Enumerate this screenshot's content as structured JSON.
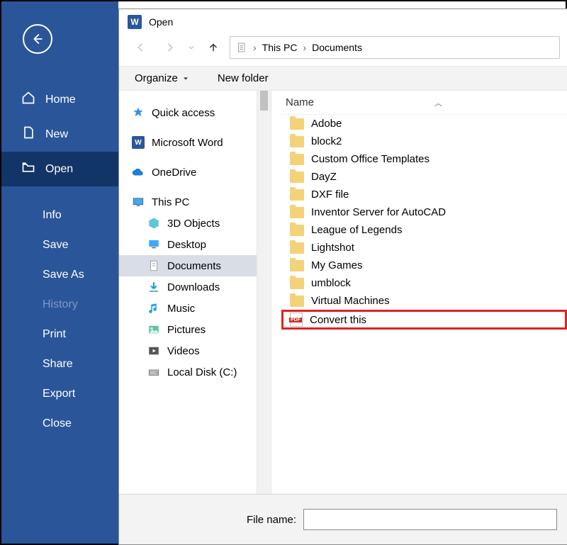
{
  "backstage": {
    "items": [
      {
        "label": "Home",
        "icon": "home-icon"
      },
      {
        "label": "New",
        "icon": "new-icon"
      },
      {
        "label": "Open",
        "icon": "open-icon",
        "selected": true
      },
      {
        "label": "Info",
        "sub": true
      },
      {
        "label": "Save",
        "sub": true
      },
      {
        "label": "Save As",
        "sub": true
      },
      {
        "label": "History",
        "sub": true,
        "dim": true
      },
      {
        "label": "Print",
        "sub": true
      },
      {
        "label": "Share",
        "sub": true
      },
      {
        "label": "Export",
        "sub": true
      },
      {
        "label": "Close",
        "sub": true
      }
    ]
  },
  "dialog": {
    "title": "Open",
    "breadcrumb": {
      "loc1": "This PC",
      "loc2": "Documents"
    },
    "toolbar": {
      "organize": "Organize",
      "newfolder": "New folder"
    },
    "tree": [
      {
        "label": "Quick access",
        "icon": "star-icon"
      },
      {
        "label": "Microsoft Word",
        "icon": "word-icon"
      },
      {
        "label": "OneDrive",
        "icon": "cloud-icon"
      },
      {
        "label": "This PC",
        "icon": "pc-icon"
      },
      {
        "label": "3D Objects",
        "icon": "cube-icon",
        "indent": true
      },
      {
        "label": "Desktop",
        "icon": "desktop-icon",
        "indent": true
      },
      {
        "label": "Documents",
        "icon": "documents-icon",
        "indent": true,
        "selected": true
      },
      {
        "label": "Downloads",
        "icon": "download-icon",
        "indent": true
      },
      {
        "label": "Music",
        "icon": "music-icon",
        "indent": true
      },
      {
        "label": "Pictures",
        "icon": "pictures-icon",
        "indent": true
      },
      {
        "label": "Videos",
        "icon": "videos-icon",
        "indent": true
      },
      {
        "label": "Local Disk (C:)",
        "icon": "disk-icon",
        "indent": true
      }
    ],
    "list_head": "Name",
    "files": [
      {
        "label": "Adobe"
      },
      {
        "label": "block2"
      },
      {
        "label": "Custom Office Templates"
      },
      {
        "label": "DayZ"
      },
      {
        "label": "DXF file"
      },
      {
        "label": "Inventor Server for AutoCAD"
      },
      {
        "label": "League of Legends"
      },
      {
        "label": "Lightshot"
      },
      {
        "label": "My Games"
      },
      {
        "label": "umblock"
      },
      {
        "label": "Virtual Machines"
      },
      {
        "label": "Convert this",
        "type": "pdf",
        "highlight": true
      }
    ],
    "filename_label": "File name:",
    "filename_value": ""
  }
}
